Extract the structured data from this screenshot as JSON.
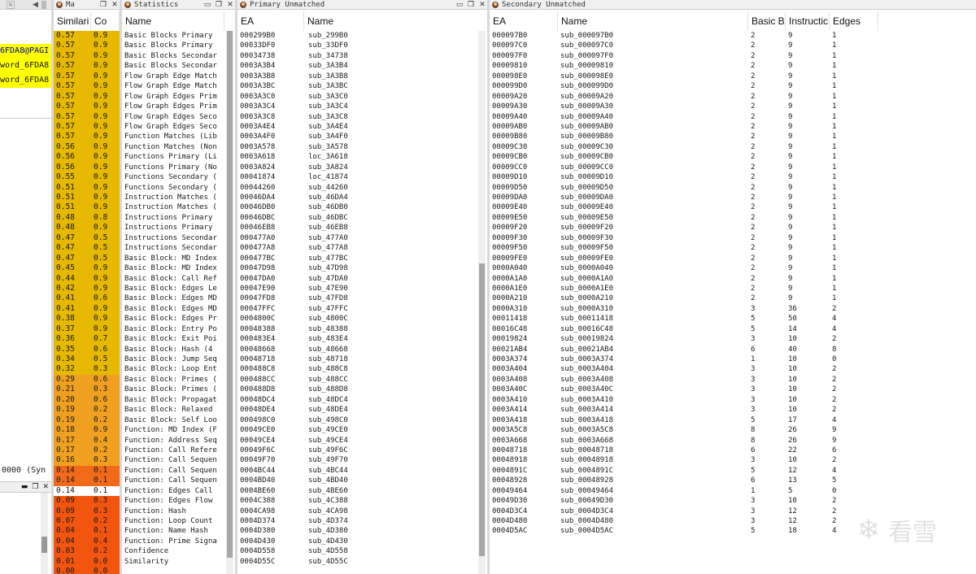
{
  "left_fragment": {
    "toolbar_close": "×",
    "code_lines": [
      "6FDA8@PAGI",
      "word_6FDA8",
      "word_6FDA8"
    ],
    "status_text": "0000 (Syn",
    "bottom_icons": [
      "pin",
      "restore",
      "close"
    ]
  },
  "matches_window": {
    "title": "Ma",
    "col_similarity": "Similari",
    "col_confidence": "Co",
    "rows": [
      [
        "0.57",
        "0.9"
      ],
      [
        "0.57",
        "0.9"
      ],
      [
        "0.57",
        "0.9"
      ],
      [
        "0.57",
        "0.9"
      ],
      [
        "0.57",
        "0.9"
      ],
      [
        "0.57",
        "0.9"
      ],
      [
        "0.57",
        "0.9"
      ],
      [
        "0.57",
        "0.9"
      ],
      [
        "0.57",
        "0.9"
      ],
      [
        "0.57",
        "0.9"
      ],
      [
        "0.57",
        "0.9"
      ],
      [
        "0.56",
        "0.9"
      ],
      [
        "0.56",
        "0.9"
      ],
      [
        "0.56",
        "0.9"
      ],
      [
        "0.55",
        "0.9"
      ],
      [
        "0.51",
        "0.9"
      ],
      [
        "0.51",
        "0.9"
      ],
      [
        "0.51",
        "0.9"
      ],
      [
        "0.48",
        "0.8"
      ],
      [
        "0.48",
        "0.9"
      ],
      [
        "0.47",
        "0.5"
      ],
      [
        "0.47",
        "0.5"
      ],
      [
        "0.47",
        "0.5"
      ],
      [
        "0.45",
        "0.9"
      ],
      [
        "0.44",
        "0.9"
      ],
      [
        "0.42",
        "0.9"
      ],
      [
        "0.41",
        "0.6"
      ],
      [
        "0.41",
        "0.9"
      ],
      [
        "0.38",
        "0.9"
      ],
      [
        "0.37",
        "0.9"
      ],
      [
        "0.36",
        "0.7"
      ],
      [
        "0.35",
        "0.6"
      ],
      [
        "0.34",
        "0.5"
      ],
      [
        "0.32",
        "0.3"
      ],
      [
        "0.29",
        "0.6"
      ],
      [
        "0.21",
        "0.3"
      ],
      [
        "0.20",
        "0.6"
      ],
      [
        "0.19",
        "0.2"
      ],
      [
        "0.19",
        "0.2"
      ],
      [
        "0.18",
        "0.9"
      ],
      [
        "0.17",
        "0.4"
      ],
      [
        "0.17",
        "0.2"
      ],
      [
        "0.16",
        "0.3"
      ],
      [
        "0.14",
        "0.1"
      ],
      [
        "0.14",
        "0.1"
      ],
      [
        "0.14",
        "0.1"
      ],
      [
        "0.09",
        "0.3"
      ],
      [
        "0.09",
        "0.3"
      ],
      [
        "0.07",
        "0.2"
      ],
      [
        "0.04",
        "0.1"
      ],
      [
        "0.04",
        "0.4"
      ],
      [
        "0.03",
        "0.2"
      ],
      [
        "0.01",
        "0.0"
      ],
      [
        "0.00",
        "0.0"
      ]
    ],
    "selected_index": 45
  },
  "statistics_window": {
    "title": "Statistics",
    "col_name": "Name",
    "rows": [
      "Basic Blocks Primary",
      "Basic Blocks Primary",
      "Basic Blocks Secondar",
      "Basic Blocks Secondar",
      "Flow Graph Edge Match",
      "Flow Graph Edge Match",
      "Flow Graph Edges Prim",
      "Flow Graph Edges Prim",
      "Flow Graph Edges Seco",
      "Flow Graph Edges Seco",
      "Function Matches (Lib",
      "Function Matches (Non",
      "Functions Primary (Li",
      "Functions Primary (No",
      "Functions Secondary (",
      "Functions Secondary (",
      "Instruction Matches (",
      "Instruction Matches (",
      "Instructions Primary",
      "Instructions Primary",
      "Instructions Secondar",
      "Instructions Secondar",
      "Basic Block: MD Index",
      "Basic Block: MD Index",
      "Basic Block: Call Ref",
      "Basic Block: Edges Le",
      "Basic Block: Edges MD",
      "Basic Block: Edges MD",
      "Basic Block: Edges Pr",
      "Basic Block: Entry Po",
      "Basic Block: Exit Poi",
      "Basic Block: Hash (4",
      "Basic Block: Jump Seq",
      "Basic Block: Loop Ent",
      "Basic Block: Primes (",
      "Basic Block: Primes (",
      "Basic Block: Propagat",
      "Basic Block: Relaxed",
      "Basic Block: Self Loo",
      "Function: MD Index (F",
      "Function: Address Seq",
      "Function: Call Refere",
      "Function: Call Sequen",
      "Function: Call Sequen",
      "Function: Call Sequen",
      "Function: Edges Call",
      "Function: Edges Flow",
      "Function: Hash",
      "Function: Loop Count",
      "Function: Name Hash",
      "Function: Prime Signa",
      "Confidence",
      "Similarity"
    ]
  },
  "primary_window": {
    "title": "Primary Unmatched",
    "col_ea": "EA",
    "col_name": "Name",
    "rows": [
      [
        "000299B0",
        "sub_299B0"
      ],
      [
        "00033DF0",
        "sub_33DF0"
      ],
      [
        "00034738",
        "sub_34738"
      ],
      [
        "0003A3B4",
        "sub_3A3B4"
      ],
      [
        "0003A3B8",
        "sub_3A3B8"
      ],
      [
        "0003A3BC",
        "sub_3A3BC"
      ],
      [
        "0003A3C0",
        "sub_3A3C0"
      ],
      [
        "0003A3C4",
        "sub_3A3C4"
      ],
      [
        "0003A3C8",
        "sub_3A3C8"
      ],
      [
        "0003A4E4",
        "sub_3A4E4"
      ],
      [
        "0003A4F0",
        "sub_3A4F0"
      ],
      [
        "0003A578",
        "sub_3A578"
      ],
      [
        "0003A618",
        "loc_3A618"
      ],
      [
        "0003A824",
        "sub_3A824"
      ],
      [
        "00041874",
        "loc_41874"
      ],
      [
        "00044260",
        "sub_44260"
      ],
      [
        "00046DA4",
        "sub_46DA4"
      ],
      [
        "00046DB0",
        "sub_46DB0"
      ],
      [
        "00046DBC",
        "sub_46DBC"
      ],
      [
        "00046EB8",
        "sub_46EB8"
      ],
      [
        "000477A0",
        "sub_477A0"
      ],
      [
        "000477A8",
        "sub_477A8"
      ],
      [
        "000477BC",
        "sub_477BC"
      ],
      [
        "00047D98",
        "sub_47D98"
      ],
      [
        "00047DA0",
        "sub_47DA0"
      ],
      [
        "00047E90",
        "sub_47E90"
      ],
      [
        "00047FD8",
        "sub_47FD8"
      ],
      [
        "00047FFC",
        "sub_47FFC"
      ],
      [
        "0004800C",
        "sub_4800C"
      ],
      [
        "00048388",
        "sub_48388"
      ],
      [
        "000483E4",
        "sub_483E4"
      ],
      [
        "00048668",
        "sub_48668"
      ],
      [
        "00048718",
        "sub_48718"
      ],
      [
        "000488C8",
        "sub_488C8"
      ],
      [
        "000488CC",
        "sub_488CC"
      ],
      [
        "000488D8",
        "sub_488D8"
      ],
      [
        "00048DC4",
        "sub_48DC4"
      ],
      [
        "00048DE4",
        "sub_48DE4"
      ],
      [
        "000498C0",
        "sub_498C0"
      ],
      [
        "00049CE0",
        "sub_49CE0"
      ],
      [
        "00049CE4",
        "sub_49CE4"
      ],
      [
        "00049F6C",
        "sub_49F6C"
      ],
      [
        "00049F70",
        "sub_49F70"
      ],
      [
        "0004BC44",
        "sub_4BC44"
      ],
      [
        "0004BD40",
        "sub_4BD40"
      ],
      [
        "0004BE60",
        "sub_4BE60"
      ],
      [
        "0004C388",
        "sub_4C388"
      ],
      [
        "0004CA98",
        "sub_4CA98"
      ],
      [
        "0004D374",
        "sub_4D374"
      ],
      [
        "0004D380",
        "sub_4D380"
      ],
      [
        "0004D430",
        "sub_4D430"
      ],
      [
        "0004D558",
        "sub_4D558"
      ],
      [
        "0004D55C",
        "sub_4D55C"
      ]
    ]
  },
  "secondary_window": {
    "title": "Secondary Unmatched",
    "col_ea": "EA",
    "col_name": "Name",
    "col_bb": "Basic Bl",
    "col_instr": "Instructic",
    "col_edges": "Edges",
    "rows": [
      [
        "000097B0",
        "sub_000097B0",
        "2",
        "9",
        "1"
      ],
      [
        "000097C0",
        "sub_000097C0",
        "2",
        "9",
        "1"
      ],
      [
        "000097F0",
        "sub_000097F0",
        "2",
        "9",
        "1"
      ],
      [
        "00009810",
        "sub_00009810",
        "2",
        "9",
        "1"
      ],
      [
        "000098E0",
        "sub_000098E0",
        "2",
        "9",
        "1"
      ],
      [
        "000099D0",
        "sub_000099D0",
        "2",
        "9",
        "1"
      ],
      [
        "00009A20",
        "sub_00009A20",
        "2",
        "9",
        "1"
      ],
      [
        "00009A30",
        "sub_00009A30",
        "2",
        "9",
        "1"
      ],
      [
        "00009A40",
        "sub_00009A40",
        "2",
        "9",
        "1"
      ],
      [
        "00009AB0",
        "sub_00009AB0",
        "2",
        "9",
        "1"
      ],
      [
        "00009B80",
        "sub_00009B80",
        "2",
        "9",
        "1"
      ],
      [
        "00009C30",
        "sub_00009C30",
        "2",
        "9",
        "1"
      ],
      [
        "00009CB0",
        "sub_00009CB0",
        "2",
        "9",
        "1"
      ],
      [
        "00009CC0",
        "sub_00009CC0",
        "2",
        "9",
        "1"
      ],
      [
        "00009D10",
        "sub_00009D10",
        "2",
        "9",
        "1"
      ],
      [
        "00009D50",
        "sub_00009D50",
        "2",
        "9",
        "1"
      ],
      [
        "00009DA0",
        "sub_00009DA0",
        "2",
        "9",
        "1"
      ],
      [
        "00009E40",
        "sub_00009E40",
        "2",
        "9",
        "1"
      ],
      [
        "00009E50",
        "sub_00009E50",
        "2",
        "9",
        "1"
      ],
      [
        "00009F20",
        "sub_00009F20",
        "2",
        "9",
        "1"
      ],
      [
        "00009F30",
        "sub_00009F30",
        "2",
        "9",
        "1"
      ],
      [
        "00009F50",
        "sub_00009F50",
        "2",
        "9",
        "1"
      ],
      [
        "00009FE0",
        "sub_00009FE0",
        "2",
        "9",
        "1"
      ],
      [
        "0000A040",
        "sub_0000A040",
        "2",
        "9",
        "1"
      ],
      [
        "0000A1A0",
        "sub_0000A1A0",
        "2",
        "9",
        "1"
      ],
      [
        "0000A1E0",
        "sub_0000A1E0",
        "2",
        "9",
        "1"
      ],
      [
        "0000A210",
        "sub_0000A210",
        "2",
        "9",
        "1"
      ],
      [
        "0000A310",
        "sub_0000A310",
        "3",
        "36",
        "2"
      ],
      [
        "00011418",
        "sub_00011418",
        "5",
        "50",
        "4"
      ],
      [
        "00016C48",
        "sub_00016C48",
        "5",
        "14",
        "4"
      ],
      [
        "00019824",
        "sub_00019824",
        "3",
        "10",
        "2"
      ],
      [
        "00021AB4",
        "sub_00021AB4",
        "6",
        "40",
        "8"
      ],
      [
        "0003A374",
        "sub_0003A374",
        "1",
        "10",
        "0"
      ],
      [
        "0003A404",
        "sub_0003A404",
        "3",
        "10",
        "2"
      ],
      [
        "0003A408",
        "sub_0003A408",
        "3",
        "10",
        "2"
      ],
      [
        "0003A40C",
        "sub_0003A40C",
        "3",
        "10",
        "2"
      ],
      [
        "0003A410",
        "sub_0003A410",
        "3",
        "10",
        "2"
      ],
      [
        "0003A414",
        "sub_0003A414",
        "3",
        "10",
        "2"
      ],
      [
        "0003A418",
        "sub_0003A418",
        "5",
        "17",
        "4"
      ],
      [
        "0003A5C8",
        "sub_0003A5C8",
        "8",
        "26",
        "9"
      ],
      [
        "0003A668",
        "sub_0003A668",
        "8",
        "26",
        "9"
      ],
      [
        "00048718",
        "sub_00048718",
        "6",
        "22",
        "6"
      ],
      [
        "00048918",
        "sub_00048918",
        "3",
        "10",
        "2"
      ],
      [
        "0004891C",
        "sub_0004891C",
        "5",
        "12",
        "4"
      ],
      [
        "00048928",
        "sub_00048928",
        "6",
        "13",
        "5"
      ],
      [
        "00049464",
        "sub_00049464",
        "1",
        "5",
        "0"
      ],
      [
        "00049D30",
        "sub_00049D30",
        "3",
        "10",
        "2"
      ],
      [
        "0004D3C4",
        "sub_0004D3C4",
        "3",
        "12",
        "2"
      ],
      [
        "0004D480",
        "sub_0004D480",
        "3",
        "12",
        "2"
      ],
      [
        "0004D5AC",
        "sub_0004D5AC",
        "5",
        "18",
        "4"
      ]
    ]
  },
  "watermark": {
    "text": "看雪"
  },
  "colors": {
    "sim_high": "#e6b800",
    "sim_mid": "#f0a020",
    "sim_low": "#f06a1a",
    "sim_lowest": "#f25510",
    "title_bg": "#f0f0f0"
  },
  "icons": [
    "app-icon",
    "close-icon",
    "pin-icon",
    "restore-icon"
  ]
}
